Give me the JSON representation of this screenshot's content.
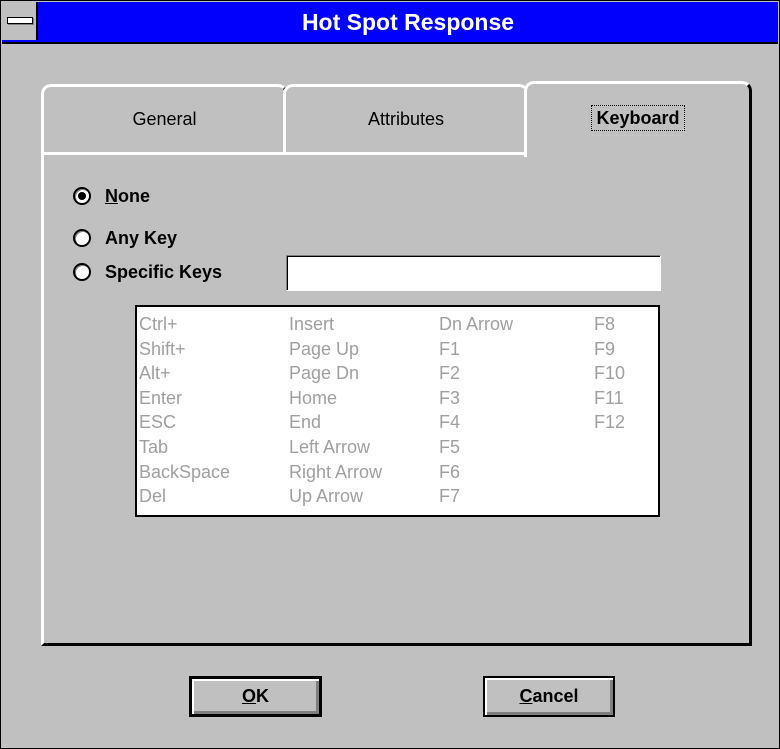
{
  "window": {
    "title": "Hot Spot Response"
  },
  "tabs": [
    {
      "label": "General"
    },
    {
      "label": "Attributes"
    },
    {
      "label": "Keyboard"
    }
  ],
  "options": {
    "none": {
      "label_key": "N",
      "label_rest": "one",
      "selected": true
    },
    "any_key": {
      "label": "Any Key",
      "selected": false
    },
    "specific_keys": {
      "label": "Specific Keys",
      "selected": false
    }
  },
  "specific_keys_field": {
    "value": ""
  },
  "key_list": {
    "columns": [
      [
        "Ctrl+",
        "Shift+",
        "Alt+",
        "Enter",
        "ESC",
        "Tab",
        "BackSpace",
        "Del"
      ],
      [
        "Insert",
        "Page Up",
        "Page Dn",
        "Home",
        "End",
        "Left Arrow",
        "Right Arrow",
        "Up Arrow"
      ],
      [
        "Dn Arrow",
        "F1",
        "F2",
        "F3",
        "F4",
        "F5",
        "F6",
        "F7"
      ],
      [
        "F8",
        "F9",
        "F10",
        "F11",
        "F12"
      ]
    ]
  },
  "buttons": {
    "ok": {
      "label_key": "O",
      "label_rest": "K"
    },
    "cancel": {
      "label_key": "C",
      "label_rest": "ancel"
    }
  }
}
